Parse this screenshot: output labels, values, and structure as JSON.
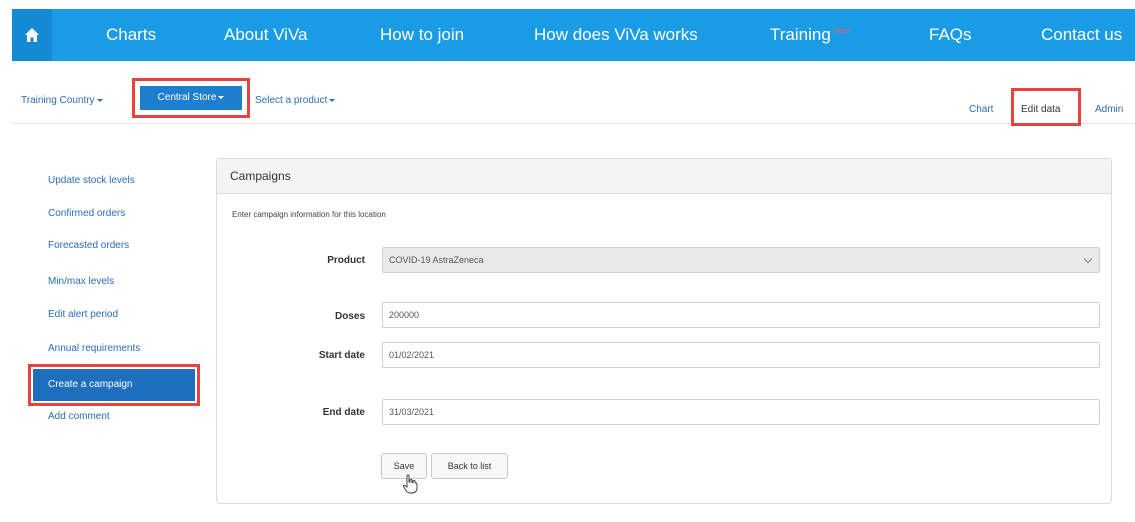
{
  "nav": {
    "home_icon": "home-icon",
    "items": [
      "Charts",
      "About ViVa",
      "How to join",
      "How does ViVa works",
      "Training",
      "FAQs",
      "Contact us"
    ],
    "training_badge": "New!"
  },
  "subnav": {
    "country": "Training Country",
    "store": "Central Store",
    "product": "Select a product",
    "right_links": [
      "Chart",
      "Edit data",
      "Admin"
    ]
  },
  "sidebar": {
    "items": [
      "Update stock levels",
      "Confirmed orders",
      "Forecasted orders",
      "Min/max levels",
      "Edit alert period",
      "Annual requirements",
      "Create a campaign",
      "Add comment"
    ],
    "active_index": 6
  },
  "panel": {
    "title": "Campaigns",
    "intro": "Enter campaign information for this location",
    "product_label": "Product",
    "product_value": "COVID-19 AstraZeneca",
    "doses_label": "Doses",
    "doses_value": "200000",
    "start_label": "Start date",
    "start_value": "01/02/2021",
    "end_label": "End date",
    "end_value": "31/03/2021",
    "save_label": "Save",
    "back_label": "Back to list"
  },
  "colors": {
    "nav_bg": "#1a9be6",
    "active_bg": "#1f6fbf",
    "highlight": "#e6423f",
    "link": "#2a6db5"
  }
}
